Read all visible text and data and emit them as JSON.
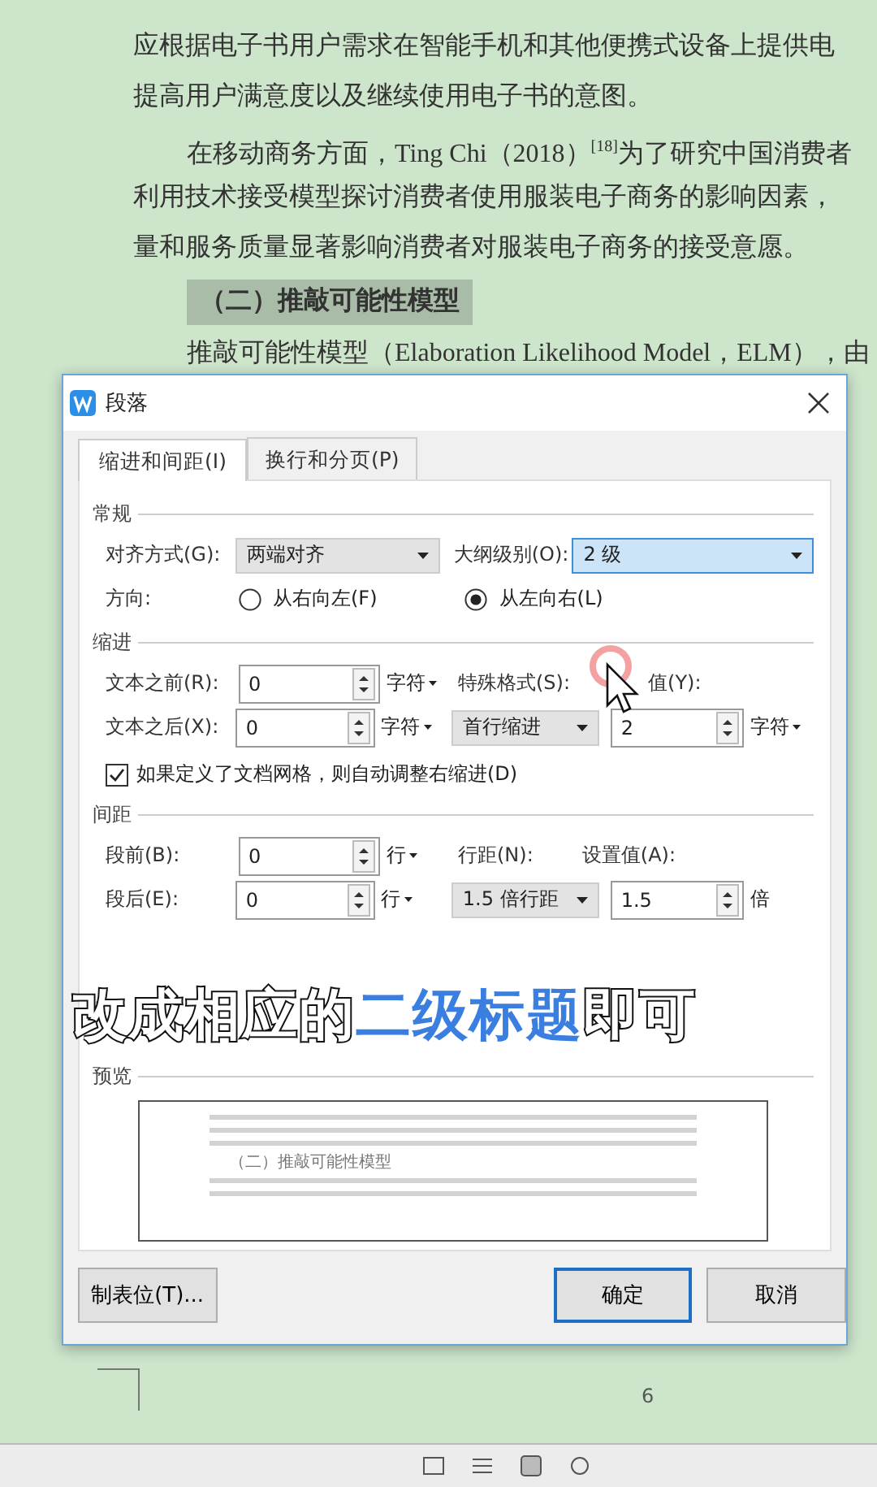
{
  "document": {
    "lines": [
      {
        "text": "应根据电子书用户需求在智能手机和其他便携式设备上提供电",
        "kind": "body"
      },
      {
        "text": "提高用户满意度以及继续使用电子书的意图。",
        "kind": "body"
      },
      {
        "text": "在移动商务方面，Ting Chi（2018）$^{[18]}$为了研究中国消费者",
        "kind": "indent"
      },
      {
        "text": "利用技术接受模型探讨消费者使用服装电子商务的影响因素，",
        "kind": "body"
      },
      {
        "text": "量和服务质量显著影响消费者对服装电子商务的接受意愿。",
        "kind": "body"
      },
      {
        "text": "（二）推敲可能性模型",
        "kind": "heading"
      },
      {
        "text": "推敲可能性模型（Elaboration Likelihood Model，ELM），由",
        "kind": "indent"
      }
    ],
    "page_number": "6"
  },
  "dialog": {
    "title": "段落",
    "tabs": [
      {
        "label": "缩进和间距(I)",
        "selected": true
      },
      {
        "label": "换行和分页(P)",
        "selected": false
      }
    ],
    "general": {
      "heading": "常规",
      "alignment": {
        "label": "对齐方式(G):",
        "value": "两端对齐"
      },
      "outline": {
        "label": "大纲级别(O):",
        "value": "2 级",
        "focused": true
      },
      "direction": {
        "label": "方向:",
        "options": [
          {
            "label": "从右向左(F)",
            "selected": false
          },
          {
            "label": "从左向右(L)",
            "selected": true
          }
        ]
      }
    },
    "indent": {
      "heading": "缩进",
      "before": {
        "label": "文本之前(R):",
        "value": "0",
        "unit": "字符"
      },
      "after": {
        "label": "文本之后(X):",
        "value": "0",
        "unit": "字符"
      },
      "special": {
        "label": "特殊格式(S):",
        "value": "首行缩进"
      },
      "measure": {
        "label": "值(Y):",
        "value": "2",
        "unit": "字符"
      },
      "auto_adjust": {
        "label": "如果定义了文档网格，则自动调整右缩进(D)",
        "checked": true
      }
    },
    "spacing": {
      "heading": "间距",
      "before": {
        "label": "段前(B):",
        "value": "0",
        "unit": "行"
      },
      "after": {
        "label": "段后(E):",
        "value": "0",
        "unit": "行"
      },
      "line": {
        "label": "行距(N):",
        "value": "1.5 倍行距"
      },
      "setting": {
        "label": "设置值(A):",
        "value": "1.5",
        "unit": "倍"
      }
    },
    "preview": {
      "heading": "预览",
      "sample_heading": "（二）推敲可能性模型"
    },
    "buttons": [
      {
        "label": "制表位(T)...",
        "kind": "secondary"
      },
      {
        "label": "确定",
        "kind": "default"
      },
      {
        "label": "取消",
        "kind": "secondary"
      }
    ]
  },
  "caption": [
    {
      "text": "改成相应的",
      "highlight": false
    },
    {
      "text": "二级标题",
      "highlight": true
    },
    {
      "text": "即可",
      "highlight": false
    }
  ]
}
